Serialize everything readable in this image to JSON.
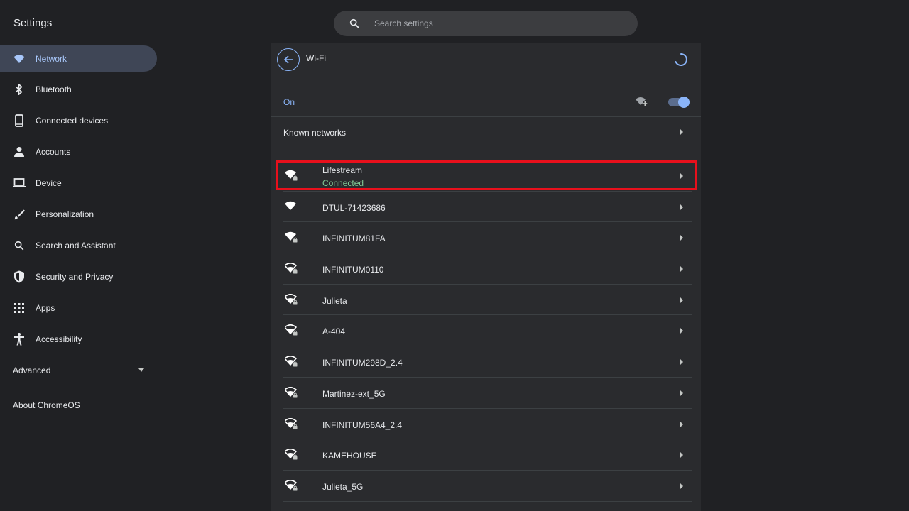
{
  "app": {
    "title": "Settings"
  },
  "search": {
    "placeholder": "Search settings"
  },
  "sidebar": {
    "items": [
      {
        "label": "Network",
        "icon": "wifi-icon",
        "active": true
      },
      {
        "label": "Bluetooth",
        "icon": "bluetooth-icon"
      },
      {
        "label": "Connected devices",
        "icon": "phone-icon"
      },
      {
        "label": "Accounts",
        "icon": "person-icon"
      },
      {
        "label": "Device",
        "icon": "laptop-icon"
      },
      {
        "label": "Personalization",
        "icon": "brush-icon"
      },
      {
        "label": "Search and Assistant",
        "icon": "search-icon"
      },
      {
        "label": "Security and Privacy",
        "icon": "shield-icon"
      },
      {
        "label": "Apps",
        "icon": "apps-grid-icon"
      },
      {
        "label": "Accessibility",
        "icon": "accessibility-icon"
      }
    ],
    "advanced_label": "Advanced",
    "about_label": "About ChromeOS"
  },
  "panel": {
    "title": "Wi-Fi",
    "on_label": "On",
    "wifi_enabled": true,
    "known_networks_label": "Known networks"
  },
  "networks": [
    {
      "name": "Lifestream",
      "status": "Connected",
      "secured": true,
      "signal": "full",
      "highlighted": true
    },
    {
      "name": "DTUL-71423686",
      "secured": false,
      "signal": "full"
    },
    {
      "name": "INFINITUM81FA",
      "secured": true,
      "signal": "full"
    },
    {
      "name": "INFINITUM0110",
      "secured": true,
      "signal": "medium"
    },
    {
      "name": "Julieta",
      "secured": true,
      "signal": "medium"
    },
    {
      "name": "A-404",
      "secured": true,
      "signal": "medium"
    },
    {
      "name": "INFINITUM298D_2.4",
      "secured": true,
      "signal": "medium"
    },
    {
      "name": "Martinez-ext_5G",
      "secured": true,
      "signal": "medium"
    },
    {
      "name": "INFINITUM56A4_2.4",
      "secured": true,
      "signal": "medium"
    },
    {
      "name": "KAMEHOUSE",
      "secured": true,
      "signal": "medium"
    },
    {
      "name": "Julieta_5G",
      "secured": true,
      "signal": "medium"
    }
  ],
  "colors": {
    "accent": "#8ab4f8",
    "connected": "#81c995",
    "highlight": "#e8101c"
  }
}
